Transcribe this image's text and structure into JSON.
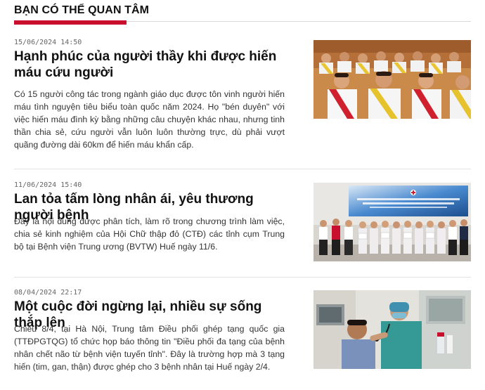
{
  "section": {
    "title": "BẠN CÓ THỂ QUAN TÂM"
  },
  "articles": [
    {
      "date": "15/06/2024 14:50",
      "title": "Hạnh phúc của người thầy khi được hiến máu cứu người",
      "summary": "Có 15 người công tác trong ngành giáo dục được tôn vinh người hiến máu tình nguyện tiêu biểu toàn quốc năm 2024. Họ \"bén duyên\" với việc hiến máu đình kỳ bằng những câu chuyện khác nhau, nhưng tinh thần chia sẻ, cứu người vẫn luôn luôn thường trực, dù phải vượt quãng đường dài 60km để hiến máu khẩn cấp.",
      "image": "photo-blood-donors-ceremony"
    },
    {
      "date": "11/06/2024 15:40",
      "title": "Lan tỏa tấm lòng nhân ái, yêu thương người bệnh",
      "summary": "Đây là nội dung được phân tích, làm rõ trong chương trình làm việc, chia sẻ kinh nghiệm của Hội Chữ thập đỏ (CTĐ) các tỉnh cụm Trung bộ tại Bệnh viện Trung ương (BVTW) Huế ngày 11/6.",
      "image": "photo-red-cross-group"
    },
    {
      "date": "08/04/2024 22:17",
      "title": "Một cuộc đời ngừng lại, nhiều sự sống thắp lên",
      "summary": "Chiều 8/4, tại Hà Nội, Trung tâm Điều phối ghép tạng quốc gia (TTĐPGTQG) tổ chức họp báo thông tin \"Điều phối đa tạng của bệnh nhân chết não từ bệnh viện tuyến tỉnh\". Đây là trường hợp mà 3 tạng hiến (tim, gan, thận) được ghép cho 3 bệnh nhân tại Huế ngày 2/4.",
      "image": "photo-doctor-patient"
    }
  ]
}
